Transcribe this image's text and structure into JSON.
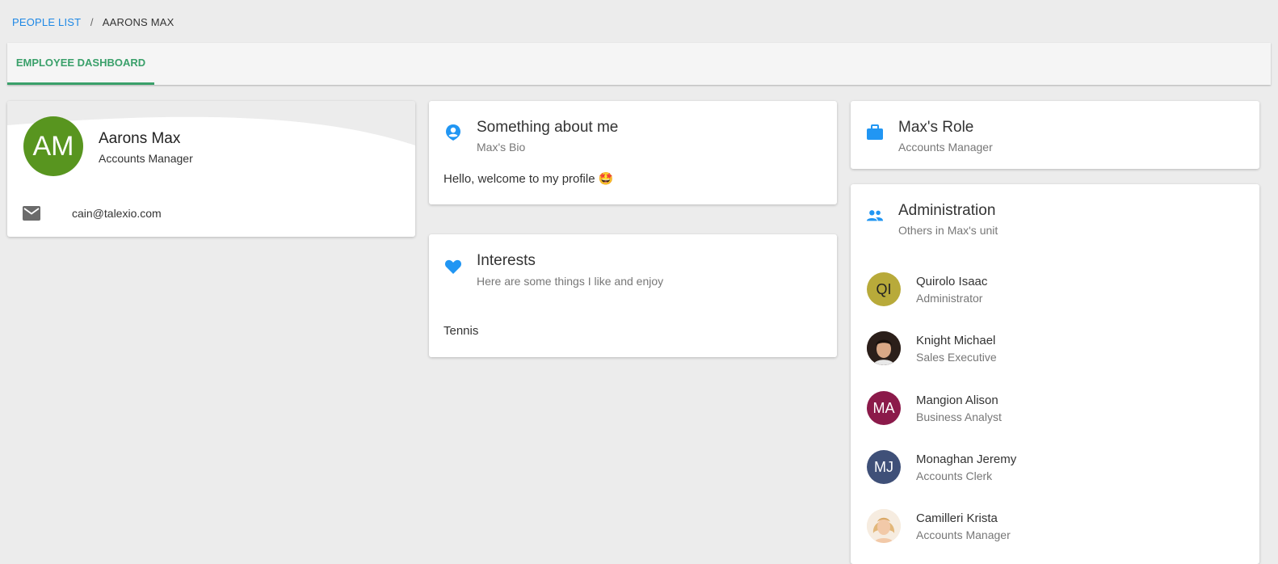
{
  "breadcrumb": {
    "link": "PEOPLE LIST",
    "separator": "/",
    "current": "AARONS MAX"
  },
  "tabs": [
    {
      "label": "EMPLOYEE DASHBOARD",
      "active": true,
      "color": "#3aa06a"
    }
  ],
  "profile": {
    "initials": "AM",
    "avatar_color": "#58951f",
    "name": "Aarons Max",
    "role": "Accounts Manager",
    "email": "cain@talexio.com",
    "email_icon": "mail-icon"
  },
  "about": {
    "icon": "account-pin-icon",
    "title": "Something about me",
    "subtitle": "Max's Bio",
    "body": "Hello, welcome to my profile 🤩"
  },
  "interests": {
    "icon": "heart-icon",
    "title": "Interests",
    "subtitle": "Here are some things I like and enjoy",
    "items": [
      "Tennis"
    ]
  },
  "role_card": {
    "icon": "briefcase-icon",
    "title": "Max's Role",
    "subtitle": "Accounts Manager"
  },
  "admin": {
    "icon": "people-icon",
    "title": "Administration",
    "subtitle": "Others in Max's unit",
    "members": [
      {
        "name": "Quirolo Isaac",
        "role": "Administrator",
        "initials": "QI",
        "avatar_color": "#b8aa3a",
        "photo": false
      },
      {
        "name": "Knight Michael",
        "role": "Sales Executive",
        "initials": "",
        "avatar_color": "#3b2a22",
        "photo": true
      },
      {
        "name": "Mangion Alison",
        "role": "Business Analyst",
        "initials": "MA",
        "avatar_color": "#8b1a4a",
        "photo": false
      },
      {
        "name": "Monaghan Jeremy",
        "role": "Accounts Clerk",
        "initials": "MJ",
        "avatar_color": "#3f5078",
        "photo": false
      },
      {
        "name": "Camilleri Krista",
        "role": "Accounts Manager",
        "initials": "",
        "avatar_color": "#e8c9a0",
        "photo": true
      }
    ]
  },
  "colors": {
    "accent_blue": "#2196f3",
    "accent_green": "#3aa06a",
    "background": "#ececec"
  }
}
